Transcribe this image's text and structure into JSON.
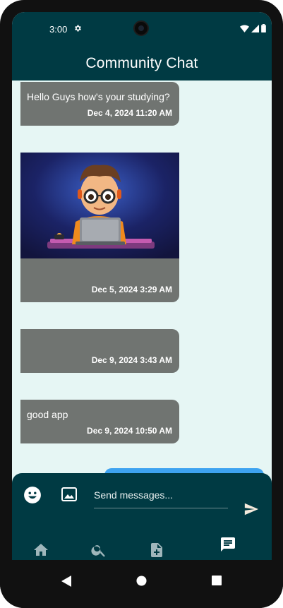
{
  "status_bar": {
    "time": "3:00"
  },
  "app_bar": {
    "title": "Community Chat"
  },
  "messages": [
    {
      "text": "Hello Guys how's your studying?",
      "timestamp": "Dec 4, 2024 11:20 AM"
    },
    {
      "text": "",
      "timestamp": "Dec 5, 2024 3:29 AM",
      "has_image": true
    },
    {
      "text": "",
      "timestamp": "Dec 9, 2024 3:43 AM"
    },
    {
      "text": "good app",
      "timestamp": "Dec 9, 2024 10:50 AM"
    }
  ],
  "composer": {
    "placeholder": "Send messages..."
  },
  "colors": {
    "primary": "#003a43",
    "background": "#e6f6f4",
    "bubble": "#707471",
    "accent_blue": "#3ea3f0"
  },
  "icons": [
    "emoji-icon",
    "image-icon",
    "send-icon",
    "home-icon",
    "search-icon",
    "add-document-icon",
    "chat-icon",
    "scroll-down-icon"
  ]
}
